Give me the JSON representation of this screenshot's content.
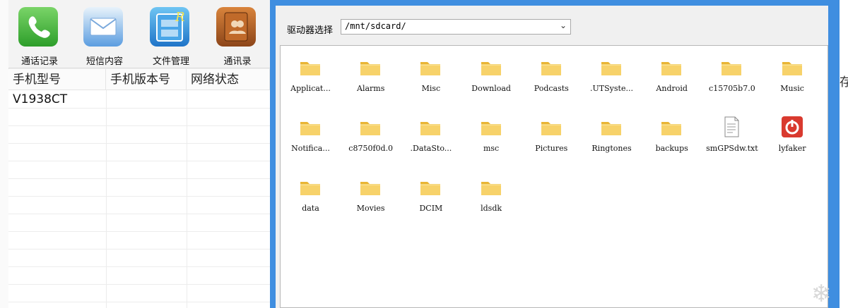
{
  "toolbar": {
    "items": [
      {
        "label": "通话记录",
        "icon": "phone-icon"
      },
      {
        "label": "短信内容",
        "icon": "mail-icon"
      },
      {
        "label": "文件管理",
        "icon": "file-cabinet-icon"
      },
      {
        "label": "通讯录",
        "icon": "contacts-book-icon"
      }
    ]
  },
  "grid": {
    "columns": [
      "手机型号",
      "手机版本号",
      "网络状态"
    ],
    "rows": [
      [
        "V1938CT",
        "",
        ""
      ]
    ]
  },
  "right_clip_text": "存",
  "dialog": {
    "drive_label": "驱动器选择",
    "drive_value": "/mnt/sdcard/",
    "files": [
      {
        "name": "Applicat...",
        "type": "folder"
      },
      {
        "name": "Alarms",
        "type": "folder"
      },
      {
        "name": "Misc",
        "type": "folder"
      },
      {
        "name": "Download",
        "type": "folder"
      },
      {
        "name": "Podcasts",
        "type": "folder"
      },
      {
        "name": ".UTSyste...",
        "type": "folder"
      },
      {
        "name": "Android",
        "type": "folder"
      },
      {
        "name": "c15705b7.0",
        "type": "folder"
      },
      {
        "name": "Music",
        "type": "folder"
      },
      {
        "name": "Notifica...",
        "type": "folder"
      },
      {
        "name": "c8750f0d.0",
        "type": "folder"
      },
      {
        "name": ".DataSto...",
        "type": "folder"
      },
      {
        "name": "msc",
        "type": "folder"
      },
      {
        "name": "Pictures",
        "type": "folder"
      },
      {
        "name": "Ringtones",
        "type": "folder"
      },
      {
        "name": "backups",
        "type": "folder"
      },
      {
        "name": "smGPSdw.txt",
        "type": "text-file"
      },
      {
        "name": "lyfaker",
        "type": "app-power"
      },
      {
        "name": "data",
        "type": "folder"
      },
      {
        "name": "Movies",
        "type": "folder"
      },
      {
        "name": "DCIM",
        "type": "folder"
      },
      {
        "name": "ldsdk",
        "type": "folder"
      }
    ]
  },
  "colors": {
    "dialog_frame": "#3f8ee0",
    "folder": "#f5c84a",
    "app_red": "#d93a2f"
  }
}
